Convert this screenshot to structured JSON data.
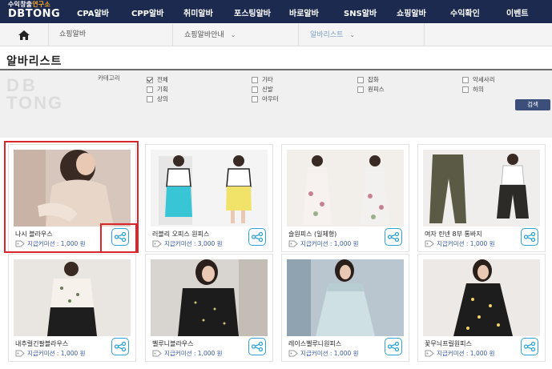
{
  "logo": {
    "line1_a": "수익창출",
    "line1_b": "연구소",
    "line2": "DBTONG"
  },
  "nav": [
    "CPA알바",
    "CPP알바",
    "취미알바",
    "포스팅알바",
    "바로알바",
    "SNS알바",
    "쇼핑알바",
    "수익확인",
    "이벤트"
  ],
  "breadcrumb": [
    "쇼핑알바",
    "쇼핑알바안내",
    "알바리스트"
  ],
  "page_title": "알바리스트",
  "watermark": "DBTONG",
  "filter": {
    "label": "카테고리",
    "options": [
      {
        "label": "전체",
        "checked": true
      },
      {
        "label": "기획",
        "checked": false
      },
      {
        "label": "상의",
        "checked": false
      },
      {
        "label": "기타",
        "checked": false
      },
      {
        "label": "신발",
        "checked": false
      },
      {
        "label": "아우터",
        "checked": false
      },
      {
        "label": "잡화",
        "checked": false
      },
      {
        "label": "원피스",
        "checked": false
      },
      {
        "label": "악세사리",
        "checked": false
      },
      {
        "label": "하의",
        "checked": false
      }
    ],
    "search_label": "검색"
  },
  "products": [
    {
      "name": "나시 블라우스",
      "commission": "지급커미션 : 1,000 원"
    },
    {
      "name": "러블리 오피스 원피스",
      "commission": "지급커미션 : 3,000 원"
    },
    {
      "name": "슬원피스 (일체형)",
      "commission": "지급커미션 : 1,000 원"
    },
    {
      "name": "여자 린넨 8부 통바지",
      "commission": "지급커미션 : 1,000 원"
    },
    {
      "name": "내추럴긴팔블라우스",
      "commission": "지급커미션 : 1,000 원"
    },
    {
      "name": "벨루니블라우스",
      "commission": "지급커미션 : 1,000 원"
    },
    {
      "name": "레이스벨루니원피스",
      "commission": "지급커미션 : 1,000 원"
    },
    {
      "name": "꽃무늬프릴원피스",
      "commission": "지급커미션 : 1,000 원"
    }
  ],
  "colors": {
    "nav_bg": "#1d2a4f",
    "accent": "#2ea3d8",
    "highlight": "#d9262c",
    "commission_text": "#3b5aa8"
  }
}
